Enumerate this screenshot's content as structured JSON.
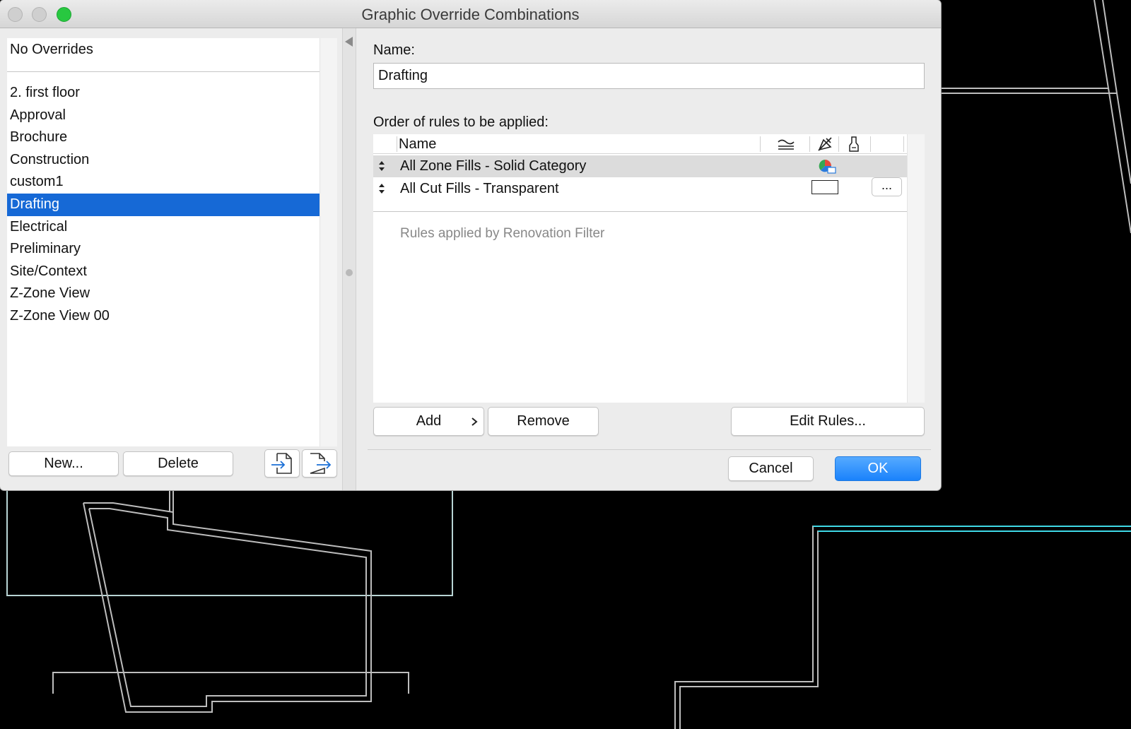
{
  "window": {
    "title": "Graphic Override Combinations"
  },
  "combinations": {
    "no_overrides": "No Overrides",
    "items": [
      {
        "label": "2. first floor"
      },
      {
        "label": "Approval"
      },
      {
        "label": "Brochure"
      },
      {
        "label": "Construction"
      },
      {
        "label": "custom1"
      },
      {
        "label": "Drafting",
        "selected": true
      },
      {
        "label": "Electrical"
      },
      {
        "label": "Preliminary"
      },
      {
        "label": "Site/Context"
      },
      {
        "label": "Z-Zone View"
      },
      {
        "label": "Z-Zone View 00"
      }
    ],
    "new_label": "New...",
    "delete_label": "Delete"
  },
  "details": {
    "name_label": "Name:",
    "name_value": "Drafting",
    "rules_heading": "Order of rules to be applied:",
    "table": {
      "column_name": "Name",
      "rules": [
        {
          "name": "All Zone Fills - Solid Category",
          "highlighted": true
        },
        {
          "name": "All Cut Fills - Transparent",
          "highlighted": false
        }
      ],
      "more_label": "...",
      "renovation_note": "Rules applied by Renovation Filter"
    },
    "add_label": "Add",
    "remove_label": "Remove",
    "edit_rules_label": "Edit Rules..."
  },
  "footer": {
    "cancel_label": "Cancel",
    "ok_label": "OK"
  },
  "colors": {
    "selection": "#1669d6",
    "ok_button": "#1a82fb",
    "drawing_line": "#c8c8c8",
    "drawing_cyan": "#3fd9e6"
  }
}
